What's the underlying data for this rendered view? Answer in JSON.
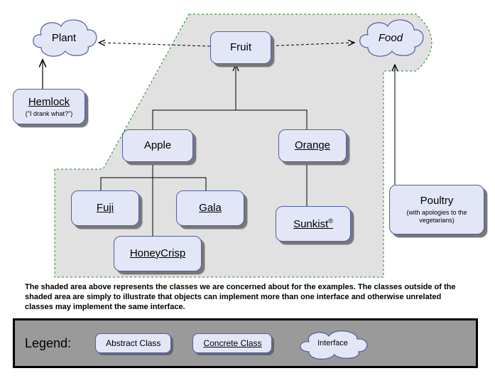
{
  "nodes": {
    "plant": {
      "label": "Plant",
      "type": "interface"
    },
    "food": {
      "label": "Food",
      "type": "interface"
    },
    "fruit": {
      "label": "Fruit",
      "type": "abstract"
    },
    "apple": {
      "label": "Apple",
      "type": "abstract"
    },
    "orange": {
      "label": "Orange",
      "type": "concrete"
    },
    "fuji": {
      "label": "Fuji",
      "type": "concrete"
    },
    "gala": {
      "label": "Gala",
      "type": "concrete"
    },
    "honeycrisp": {
      "label": "HoneyCrisp",
      "type": "concrete"
    },
    "sunkist": {
      "label": "Sunkist",
      "suffix": "®",
      "type": "concrete"
    },
    "hemlock": {
      "label": "Hemlock",
      "subtitle": "(\"I drank what?\")",
      "type": "concrete"
    },
    "poultry": {
      "label": "Poultry",
      "subtitle": "(with apologies to the vegetarians)",
      "type": "abstract"
    }
  },
  "edges": [
    {
      "from": "hemlock",
      "to": "plant",
      "style": "solid"
    },
    {
      "from": "fruit",
      "to": "plant",
      "style": "dashed"
    },
    {
      "from": "fruit",
      "to": "food",
      "style": "dashed"
    },
    {
      "from": "apple",
      "to": "fruit",
      "style": "solid"
    },
    {
      "from": "orange",
      "to": "fruit",
      "style": "solid"
    },
    {
      "from": "fuji",
      "to": "apple",
      "style": "solid"
    },
    {
      "from": "gala",
      "to": "apple",
      "style": "solid"
    },
    {
      "from": "honeycrisp",
      "to": "apple",
      "style": "solid"
    },
    {
      "from": "sunkist",
      "to": "orange",
      "style": "solid"
    },
    {
      "from": "poultry",
      "to": "food",
      "style": "solid"
    }
  ],
  "caption": "The shaded area above represents the classes we are concerned about for the examples.  The classes outside of the shaded area are simply to illustrate that objects can implement more than one interface and otherwise unrelated classes may implement the same interface.",
  "legend": {
    "title": "Legend:",
    "abstract": "Abstract Class",
    "concrete": "Concrete Class",
    "interface": "Interface"
  }
}
